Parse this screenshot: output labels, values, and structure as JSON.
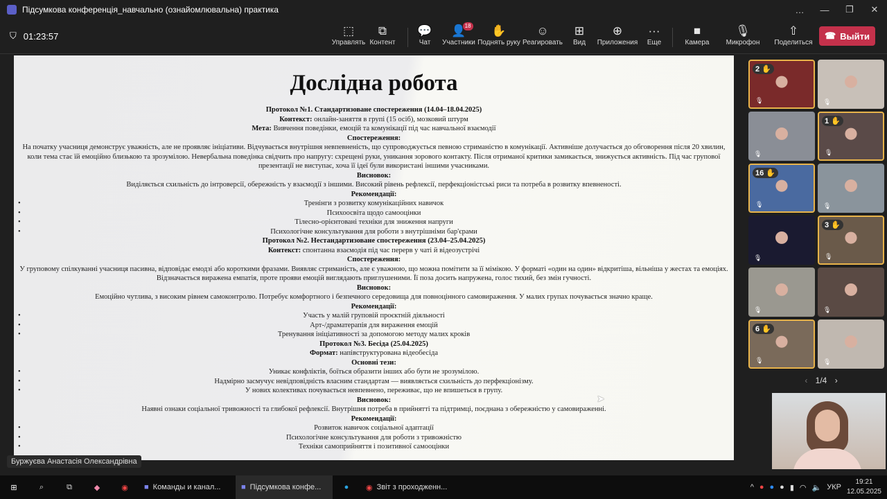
{
  "window": {
    "title": "Підсумкова конференція_навчально (ознайомлювальна) практика",
    "controls": [
      "…",
      "—",
      "❐",
      "✕"
    ]
  },
  "toolbar": {
    "timer": "01:23:57",
    "items": [
      {
        "label": "Управлять",
        "icon": "share-screen-control-icon",
        "glyph": "⬚"
      },
      {
        "label": "Контент",
        "icon": "content-icon",
        "glyph": "⧉"
      },
      {
        "label": "Чат",
        "icon": "chat-icon",
        "glyph": "💬"
      },
      {
        "label": "Участники",
        "icon": "people-icon",
        "glyph": "👤",
        "badge": "18"
      },
      {
        "label": "Поднять руку",
        "icon": "raise-hand-icon",
        "glyph": "✋"
      },
      {
        "label": "Реагировать",
        "icon": "smile-icon",
        "glyph": "☺"
      },
      {
        "label": "Вид",
        "icon": "grid-view-icon",
        "glyph": "⊞"
      },
      {
        "label": "Приложения",
        "icon": "apps-plus-icon",
        "glyph": "⊕"
      },
      {
        "label": "Еще",
        "icon": "more-icon",
        "glyph": "···"
      },
      {
        "label": "Камера",
        "icon": "camera-icon",
        "glyph": "■"
      },
      {
        "label": "Микрофон",
        "icon": "mic-off-icon",
        "glyph": "🎙"
      },
      {
        "label": "Поделиться",
        "icon": "share-icon",
        "glyph": "⇧"
      }
    ],
    "leave": "Выйти"
  },
  "document": {
    "title": "Дослідна робота",
    "lines": [
      {
        "t": "b",
        "text": "Протокол №1. Стандартизоване спостереження (14.04–18.04.2025)"
      },
      {
        "t": "kv",
        "k": "Контекст:",
        "v": " онлайн-заняття в групі (15 осіб), мозковий штурм"
      },
      {
        "t": "kv",
        "k": "Мета:",
        "v": " Вивчення поведінки, емоцій та комунікації під час навчальної взаємодії"
      },
      {
        "t": "b",
        "text": "Спостереження:"
      },
      {
        "t": "p",
        "text": "На початку учасниця демонструє уважність, але не проявляє ініціативи. Відчувається внутрішня невпевненість, що супроводжується певною стриманістю в комунікації. Активніше долучається до обговорення після 20 хвилин, коли тема стає їй емоційно близькою та зрозумілою. Невербальна поведінка свідчить про напругу: схрещені руки, уникання зорового контакту. Після отриманої критики замикається, знижується активність. Під час групової презентації не виступає, хоча її ідеї були використані іншими учасниками."
      },
      {
        "t": "b",
        "text": "Висновок:"
      },
      {
        "t": "p",
        "text": "Виділяється схильність до інтроверсії, обережність у взаємодії з іншими. Високий рівень рефлексії, перфекціоністські риси та потреба в розвитку впевненості."
      },
      {
        "t": "b",
        "text": "Рекомендації:"
      },
      {
        "t": "li",
        "text": "Тренінги з розвитку комунікаційних навичок"
      },
      {
        "t": "li",
        "text": "Психоосвіта щодо самооцінки"
      },
      {
        "t": "li",
        "text": "Тілесно-орієнтовані техніки для зниження напруги"
      },
      {
        "t": "li",
        "text": "Психологічне консультування для роботи з внутрішніми бар'єрами"
      },
      {
        "t": "b",
        "text": "Протокол №2. Нестандартизоване спостереження (23.04–25.04.2025)"
      },
      {
        "t": "kv",
        "k": "Контекст:",
        "v": " спонтанна взаємодія під час перерв у чаті й відеозустрічі"
      },
      {
        "t": "b",
        "text": "Спостереження:"
      },
      {
        "t": "p",
        "text": "У груповому спілкуванні учасниця пасивна, відповідає емодзі або короткими фразами. Виявляє стриманість, але є уважною, що можна помітити за її мімікою. У форматі «один на один» відкритіша, вільніша у жестах та емоціях. Відзначається виражена емпатія, проте прояви емоцій виглядають приглушеними. Її поза досить напружена, голос тихий, без змін гучності."
      },
      {
        "t": "b",
        "text": "Висновок:"
      },
      {
        "t": "p",
        "text": "Емоційно чутлива, з високим рівнем самоконтролю. Потребує комфортного і безпечного середовища для повноцінного самовираження. У малих групах почувається значно краще."
      },
      {
        "t": "b",
        "text": "Рекомендації:"
      },
      {
        "t": "li",
        "text": "Участь у малій груповій проєктній діяльності"
      },
      {
        "t": "li",
        "text": "Арт-/драматерапія для вираження емоцій"
      },
      {
        "t": "li",
        "text": "Тренування ініціативності за допомогою методу малих кроків"
      },
      {
        "t": "b",
        "text": "Протокол №3. Бесіда (25.04.2025)"
      },
      {
        "t": "kv",
        "k": "Формат:",
        "v": " напівструктурована відеобесіда"
      },
      {
        "t": "b",
        "text": "Основні тези:"
      },
      {
        "t": "li",
        "text": "Уникає конфліктів, боїться образити інших або бути не зрозумілою."
      },
      {
        "t": "li",
        "text": "Надмірно засмучує невідповідність власним стандартам — виявляється схильність до перфекціонізму."
      },
      {
        "t": "li",
        "text": "У нових колективах почувається невпевнено, переживає, що не впишеться в групу."
      },
      {
        "t": "b",
        "text": "Висновок:"
      },
      {
        "t": "p",
        "text": "Наявні ознаки соціальної тривожності та глибокої рефлексії. Внутрішня потреба в прийнятті та підтримці, поєднана з обережністю у самовираженні."
      },
      {
        "t": "b",
        "text": "Рекомендації:"
      },
      {
        "t": "li",
        "text": "Розвиток навичок соціальної адаптації"
      },
      {
        "t": "li",
        "text": "Психологічне консультування для роботи з тривожністю"
      },
      {
        "t": "li",
        "text": "Техніки самоприйняття і позитивної самооцінки"
      }
    ]
  },
  "presenter_name": "Буржуєва Анастасія Олександрівна",
  "participants": {
    "tiles": [
      {
        "hand": "2 ✋",
        "color": "#7a2a2a"
      },
      {
        "color": "#c8c0b8"
      },
      {
        "color": "#8a8e96"
      },
      {
        "hand": "1 ✋",
        "color": "#5a4a48"
      },
      {
        "hand": "16 ✋",
        "color": "#4a6aa0"
      },
      {
        "color": "#8a949c"
      },
      {
        "color": "#1a1a30"
      },
      {
        "hand": "3 ✋",
        "color": "#6a5a4a"
      },
      {
        "color": "#9a9890"
      },
      {
        "color": "#5a4a44"
      },
      {
        "hand": "6 ✋",
        "color": "#7a6a5a"
      },
      {
        "color": "#c0b8b0"
      }
    ],
    "pager": "1/4"
  },
  "taskbar": {
    "apps": [
      {
        "label": "Команды и канал...",
        "icon": "teams-icon"
      },
      {
        "label": "Підсумкова конфе...",
        "icon": "teams-icon",
        "active": true
      },
      {
        "label": "Звіт з проходженн...",
        "icon": "chrome-icon"
      }
    ],
    "language": "УКР",
    "time": "19:21",
    "date": "12.05.2025"
  }
}
